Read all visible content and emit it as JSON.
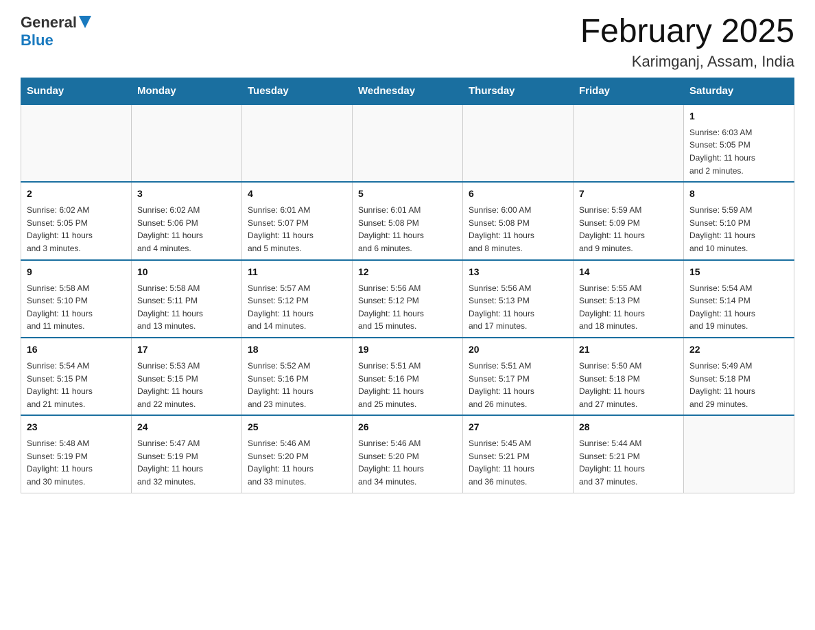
{
  "header": {
    "logo_general": "General",
    "logo_blue": "Blue",
    "month_title": "February 2025",
    "location": "Karimganj, Assam, India"
  },
  "weekdays": [
    "Sunday",
    "Monday",
    "Tuesday",
    "Wednesday",
    "Thursday",
    "Friday",
    "Saturday"
  ],
  "rows": [
    [
      {
        "day": "",
        "info": ""
      },
      {
        "day": "",
        "info": ""
      },
      {
        "day": "",
        "info": ""
      },
      {
        "day": "",
        "info": ""
      },
      {
        "day": "",
        "info": ""
      },
      {
        "day": "",
        "info": ""
      },
      {
        "day": "1",
        "info": "Sunrise: 6:03 AM\nSunset: 5:05 PM\nDaylight: 11 hours\nand 2 minutes."
      }
    ],
    [
      {
        "day": "2",
        "info": "Sunrise: 6:02 AM\nSunset: 5:05 PM\nDaylight: 11 hours\nand 3 minutes."
      },
      {
        "day": "3",
        "info": "Sunrise: 6:02 AM\nSunset: 5:06 PM\nDaylight: 11 hours\nand 4 minutes."
      },
      {
        "day": "4",
        "info": "Sunrise: 6:01 AM\nSunset: 5:07 PM\nDaylight: 11 hours\nand 5 minutes."
      },
      {
        "day": "5",
        "info": "Sunrise: 6:01 AM\nSunset: 5:08 PM\nDaylight: 11 hours\nand 6 minutes."
      },
      {
        "day": "6",
        "info": "Sunrise: 6:00 AM\nSunset: 5:08 PM\nDaylight: 11 hours\nand 8 minutes."
      },
      {
        "day": "7",
        "info": "Sunrise: 5:59 AM\nSunset: 5:09 PM\nDaylight: 11 hours\nand 9 minutes."
      },
      {
        "day": "8",
        "info": "Sunrise: 5:59 AM\nSunset: 5:10 PM\nDaylight: 11 hours\nand 10 minutes."
      }
    ],
    [
      {
        "day": "9",
        "info": "Sunrise: 5:58 AM\nSunset: 5:10 PM\nDaylight: 11 hours\nand 11 minutes."
      },
      {
        "day": "10",
        "info": "Sunrise: 5:58 AM\nSunset: 5:11 PM\nDaylight: 11 hours\nand 13 minutes."
      },
      {
        "day": "11",
        "info": "Sunrise: 5:57 AM\nSunset: 5:12 PM\nDaylight: 11 hours\nand 14 minutes."
      },
      {
        "day": "12",
        "info": "Sunrise: 5:56 AM\nSunset: 5:12 PM\nDaylight: 11 hours\nand 15 minutes."
      },
      {
        "day": "13",
        "info": "Sunrise: 5:56 AM\nSunset: 5:13 PM\nDaylight: 11 hours\nand 17 minutes."
      },
      {
        "day": "14",
        "info": "Sunrise: 5:55 AM\nSunset: 5:13 PM\nDaylight: 11 hours\nand 18 minutes."
      },
      {
        "day": "15",
        "info": "Sunrise: 5:54 AM\nSunset: 5:14 PM\nDaylight: 11 hours\nand 19 minutes."
      }
    ],
    [
      {
        "day": "16",
        "info": "Sunrise: 5:54 AM\nSunset: 5:15 PM\nDaylight: 11 hours\nand 21 minutes."
      },
      {
        "day": "17",
        "info": "Sunrise: 5:53 AM\nSunset: 5:15 PM\nDaylight: 11 hours\nand 22 minutes."
      },
      {
        "day": "18",
        "info": "Sunrise: 5:52 AM\nSunset: 5:16 PM\nDaylight: 11 hours\nand 23 minutes."
      },
      {
        "day": "19",
        "info": "Sunrise: 5:51 AM\nSunset: 5:16 PM\nDaylight: 11 hours\nand 25 minutes."
      },
      {
        "day": "20",
        "info": "Sunrise: 5:51 AM\nSunset: 5:17 PM\nDaylight: 11 hours\nand 26 minutes."
      },
      {
        "day": "21",
        "info": "Sunrise: 5:50 AM\nSunset: 5:18 PM\nDaylight: 11 hours\nand 27 minutes."
      },
      {
        "day": "22",
        "info": "Sunrise: 5:49 AM\nSunset: 5:18 PM\nDaylight: 11 hours\nand 29 minutes."
      }
    ],
    [
      {
        "day": "23",
        "info": "Sunrise: 5:48 AM\nSunset: 5:19 PM\nDaylight: 11 hours\nand 30 minutes."
      },
      {
        "day": "24",
        "info": "Sunrise: 5:47 AM\nSunset: 5:19 PM\nDaylight: 11 hours\nand 32 minutes."
      },
      {
        "day": "25",
        "info": "Sunrise: 5:46 AM\nSunset: 5:20 PM\nDaylight: 11 hours\nand 33 minutes."
      },
      {
        "day": "26",
        "info": "Sunrise: 5:46 AM\nSunset: 5:20 PM\nDaylight: 11 hours\nand 34 minutes."
      },
      {
        "day": "27",
        "info": "Sunrise: 5:45 AM\nSunset: 5:21 PM\nDaylight: 11 hours\nand 36 minutes."
      },
      {
        "day": "28",
        "info": "Sunrise: 5:44 AM\nSunset: 5:21 PM\nDaylight: 11 hours\nand 37 minutes."
      },
      {
        "day": "",
        "info": ""
      }
    ]
  ]
}
